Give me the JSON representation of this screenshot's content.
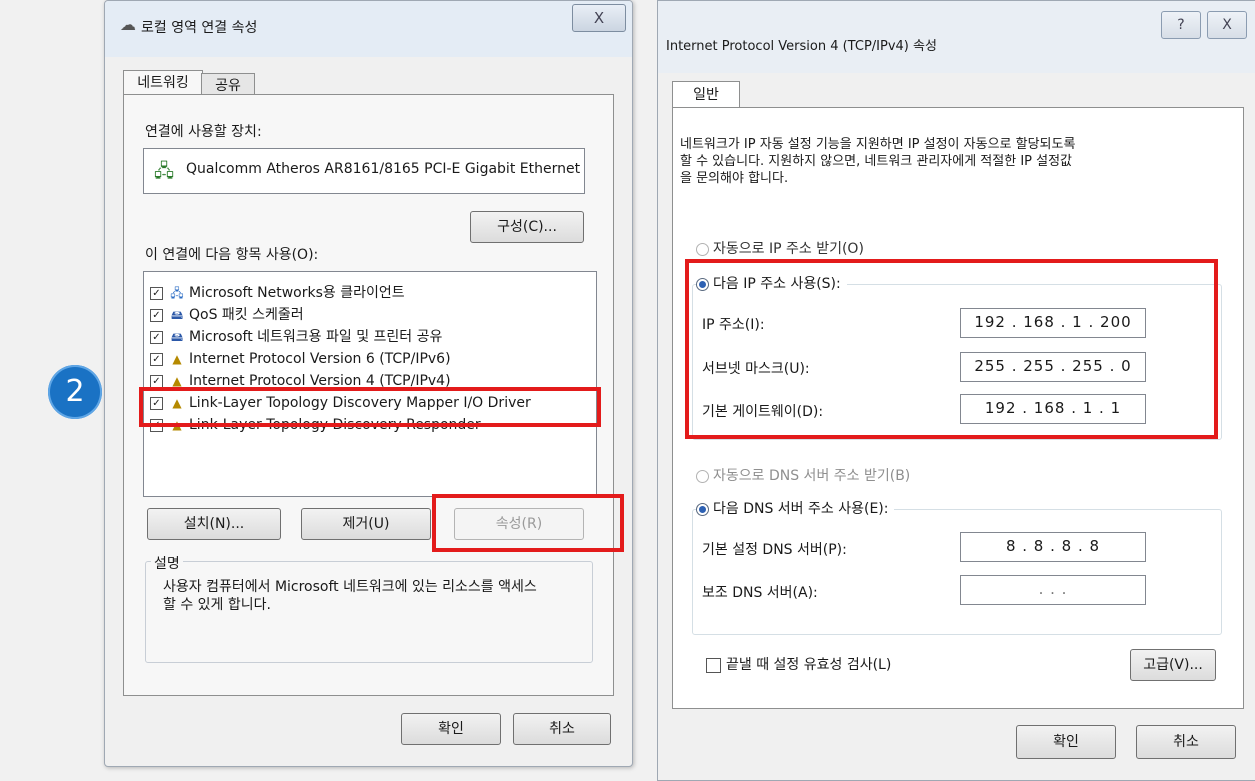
{
  "step_badge": "2",
  "dialog1": {
    "title": "로컬 영역 연결 속성",
    "close": "X",
    "tabs": [
      "네트워킹",
      "공유"
    ],
    "connect_using_label": "연결에 사용할 장치:",
    "adapter_name": "Qualcomm Atheros AR8161/8165 PCI-E Gigabit Ethernet",
    "configure_button": "구성(C)...",
    "items_label": "이 연결에 다음 항목 사용(O):",
    "items": [
      {
        "label": "Microsoft Networks용 클라이언트",
        "checked": true,
        "icon": "network-client-icon"
      },
      {
        "label": "QoS 패킷 스케줄러",
        "checked": true,
        "icon": "service-icon"
      },
      {
        "label": "Microsoft 네트워크용 파일 및 프린터 공유",
        "checked": true,
        "icon": "service-icon"
      },
      {
        "label": "Internet Protocol Version 6 (TCP/IPv6)",
        "checked": true,
        "icon": "protocol-icon"
      },
      {
        "label": "Internet Protocol Version 4 (TCP/IPv4)",
        "checked": true,
        "icon": "protocol-icon"
      },
      {
        "label": "Link-Layer Topology Discovery Mapper I/O Driver",
        "checked": true,
        "icon": "protocol-icon"
      },
      {
        "label": "Link-Layer Topology Discovery Responder",
        "checked": true,
        "icon": "protocol-icon"
      }
    ],
    "install_button": "설치(N)...",
    "uninstall_button": "제거(U)",
    "properties_button": "속성(R)",
    "description_label": "설명",
    "description_text_line1": "사용자 컴퓨터에서 Microsoft 네트워크에 있는 리소스를 액세스",
    "description_text_line2": "할 수 있게 합니다.",
    "ok_button": "확인",
    "cancel_button": "취소"
  },
  "dialog2": {
    "title": "Internet Protocol Version 4 (TCP/IPv4) 속성",
    "help": "?",
    "close": "X",
    "tab_general": "일반",
    "intro_line1": "네트워크가 IP 자동 설정 기능을 지원하면 IP 설정이 자동으로 할당되도록",
    "intro_line2": "할 수 있습니다. 지원하지 않으면, 네트워크 관리자에게 적절한 IP 설정값",
    "intro_line3": "을 문의해야 합니다.",
    "auto_ip_label": "자동으로 IP 주소 받기(O)",
    "manual_ip_label": "다음 IP 주소 사용(S):",
    "ip_address_label": "IP 주소(I):",
    "ip_address_value": "192 . 168 . 1 . 200",
    "subnet_label": "서브넷 마스크(U):",
    "subnet_value": "255 . 255 . 255 . 0",
    "gateway_label": "기본 게이트웨이(D):",
    "gateway_value": "192 . 168 . 1 . 1",
    "auto_dns_label": "자동으로 DNS 서버 주소 받기(B)",
    "manual_dns_label": "다음 DNS 서버 주소 사용(E):",
    "preferred_dns_label": "기본 설정 DNS 서버(P):",
    "preferred_dns_value": "8 . 8 . 8 . 8",
    "alternate_dns_label": "보조 DNS 서버(A):",
    "alternate_dns_value": ". . .",
    "validate_label": "끝낼 때 설정 유효성 검사(L)",
    "advanced_button": "고급(V)...",
    "ok_button": "확인",
    "cancel_button": "취소"
  }
}
